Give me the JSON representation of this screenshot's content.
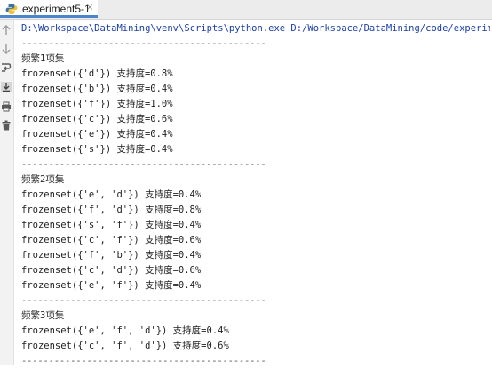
{
  "tab": {
    "title": "experiment5-1",
    "close_glyph": "×",
    "icon": "python-icon",
    "accent": "#4a86c8"
  },
  "toolbar": {
    "icons": [
      "arrow-up-icon",
      "arrow-down-icon",
      "soft-wrap-icon",
      "scroll-to-end-icon",
      "print-icon",
      "trash-icon"
    ]
  },
  "console": {
    "command": "D:\\Workspace\\DataMining\\venv\\Scripts\\python.exe D:/Workspace/DataMining/code/experiment5-1.py",
    "separator": "---------------------------------------------",
    "groups": [
      {
        "heading": "频繁1项集",
        "items": [
          "frozenset({'d'}) 支持度=0.8%",
          "frozenset({'b'}) 支持度=0.4%",
          "frozenset({'f'}) 支持度=1.0%",
          "frozenset({'c'}) 支持度=0.6%",
          "frozenset({'e'}) 支持度=0.4%",
          "frozenset({'s'}) 支持度=0.4%"
        ]
      },
      {
        "heading": "频繁2项集",
        "items": [
          "frozenset({'e', 'd'}) 支持度=0.4%",
          "frozenset({'f', 'd'}) 支持度=0.8%",
          "frozenset({'s', 'f'}) 支持度=0.4%",
          "frozenset({'c', 'f'}) 支持度=0.6%",
          "frozenset({'f', 'b'}) 支持度=0.4%",
          "frozenset({'c', 'd'}) 支持度=0.6%",
          "frozenset({'e', 'f'}) 支持度=0.4%"
        ]
      },
      {
        "heading": "频繁3项集",
        "items": [
          "frozenset({'e', 'f', 'd'}) 支持度=0.4%",
          "frozenset({'c', 'f', 'd'}) 支持度=0.6%"
        ]
      }
    ]
  }
}
